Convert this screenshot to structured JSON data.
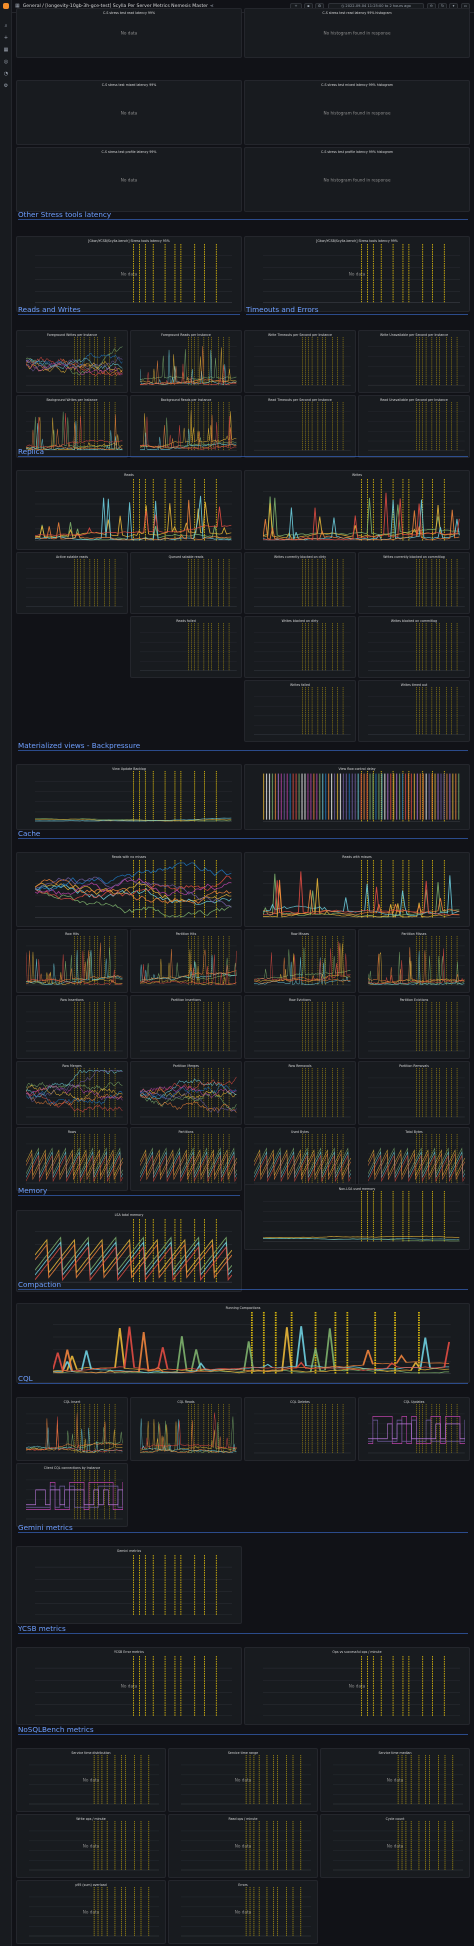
{
  "header": {
    "breadcrumb": "General / [longevity-10gb-3h-gce-test] Scylla Per Server Metrics Nemesis Master",
    "time_range": "2022-09-04 11:25:00 to 2 hours ago",
    "buttons": [
      "add",
      "save",
      "settings",
      "refresh",
      "zoom-out"
    ]
  },
  "panels_top": {
    "p1": {
      "title": "C-S stress test read latency 99%",
      "msg": "No data"
    },
    "p2": {
      "title": "C-S stress test read latency 99% histogram",
      "msg": "No histogram found in response"
    },
    "p3": {
      "title": "C-S stress test mixed latency 99%",
      "msg": "No data"
    },
    "p4": {
      "title": "C-S stress test mixed latency 99% histogram",
      "msg": "No histogram found in response"
    },
    "p5": {
      "title": "C-S stress test profile latency 99%",
      "msg": "No data"
    },
    "p6": {
      "title": "C-S stress test profile latency 99% histogram",
      "msg": "No histogram found in response"
    }
  },
  "rows": {
    "other_stress": "Other Stress tools latency",
    "reads_writes": "Reads and Writes",
    "timeouts": "Timeouts and Errors",
    "replica": "Replica",
    "mv": "Materialized views - Backpressure",
    "cache": "Cache",
    "memory": "Memory",
    "compaction": "Compaction",
    "cql": "CQL",
    "gemini": "Gemini metrics",
    "ycsb": "YCSB metrics",
    "nosqlbench": "NoSQLBench metrics"
  },
  "panels": {
    "ost1": {
      "title": "[Gkon/YCSB/Scylla-bench] Stress tools latency 95%",
      "msg": "No data"
    },
    "ost2": {
      "title": "[Gkon/YCSB/Scylla-bench] Stress tools latency 99%",
      "msg": "No data"
    },
    "rw1": {
      "title": "Foreground Writes per Instance"
    },
    "rw2": {
      "title": "Foreground Reads per Instance"
    },
    "rw3": {
      "title": "Background Writes per Instance"
    },
    "rw4": {
      "title": "Background Reads per Instance"
    },
    "te1": {
      "title": "Write Timeouts per Second per Instance"
    },
    "te2": {
      "title": "Write Unavailable per Second per Instance"
    },
    "te3": {
      "title": "Read Timeouts per Second per Instance"
    },
    "te4": {
      "title": "Read Unavailable per Second per Instance"
    },
    "re1": {
      "title": "Reads"
    },
    "re2": {
      "title": "Writes"
    },
    "re3": {
      "title": "Active sstable reads"
    },
    "re4": {
      "title": "Queued sstable reads"
    },
    "re5": {
      "title": "Writes currently blocked on dirty"
    },
    "re6": {
      "title": "Writes currently blocked on commitlog"
    },
    "re7": {
      "title": "Reads failed"
    },
    "re8": {
      "title": "Writes blocked on dirty"
    },
    "re9": {
      "title": "Writes blocked on commitlog"
    },
    "re10": {
      "title": "Writes failed"
    },
    "re11": {
      "title": "Writes timed out"
    },
    "mv1": {
      "title": "View Update Backlog"
    },
    "mv2": {
      "title": "View flow control delay"
    },
    "ca1": {
      "title": "Reads with no misses"
    },
    "ca2": {
      "title": "Reads with misses"
    },
    "ca3": {
      "title": "Row Hits"
    },
    "ca4": {
      "title": "Partition Hits"
    },
    "ca5": {
      "title": "Row Misses"
    },
    "ca6": {
      "title": "Partition Misses"
    },
    "ca7": {
      "title": "Row Insertions"
    },
    "ca8": {
      "title": "Partition Insertions"
    },
    "ca9": {
      "title": "Row Evictions"
    },
    "ca10": {
      "title": "Partition Evictions"
    },
    "ca11": {
      "title": "Row Merges"
    },
    "ca12": {
      "title": "Partition Merges"
    },
    "ca13": {
      "title": "Row Removals"
    },
    "ca14": {
      "title": "Partition Removals"
    },
    "ca15": {
      "title": "Rows"
    },
    "ca16": {
      "title": "Partitions"
    },
    "ca17": {
      "title": "Used Bytes"
    },
    "ca18": {
      "title": "Total Bytes"
    },
    "me1": {
      "title": "LSA total memory"
    },
    "me2": {
      "title": "Non-LSA used memory"
    },
    "co1": {
      "title": "Running Compactions"
    },
    "cq1": {
      "title": "CQL Insert"
    },
    "cq2": {
      "title": "CQL Reads"
    },
    "cq3": {
      "title": "CQL Deletes"
    },
    "cq4": {
      "title": "CQL Updates"
    },
    "cq5": {
      "title": "Client CQL connections by Instance"
    },
    "ge1": {
      "title": "Gemini metrics"
    },
    "yc1": {
      "title": "YCSB Error metrics",
      "msg": "No data"
    },
    "yc2": {
      "title": "Ops vs successful ops / minute",
      "msg": "No data"
    },
    "ns1": {
      "title": "Service time distribution",
      "msg": "No data"
    },
    "ns2": {
      "title": "Service time range",
      "msg": "No data"
    },
    "ns3": {
      "title": "Service time median",
      "msg": "No data"
    },
    "ns4": {
      "title": "Write ops / minute",
      "msg": "No data"
    },
    "ns5": {
      "title": "Read ops / minute",
      "msg": "No data"
    },
    "ns6": {
      "title": "Cycle count",
      "msg": "No data"
    },
    "ns7": {
      "title": "p95 (sum) overload",
      "msg": "No data"
    },
    "ns8": {
      "title": "Errors",
      "msg": "No data"
    }
  },
  "colors": {
    "accent": "#6e9fff",
    "annotation": "#f2cc0c",
    "series": [
      "#7eb26d",
      "#eab839",
      "#6ed0e0",
      "#ef843c",
      "#e24d42",
      "#1f78c1",
      "#ba43a9",
      "#705da0",
      "#b877d9",
      "#ffffff"
    ]
  }
}
